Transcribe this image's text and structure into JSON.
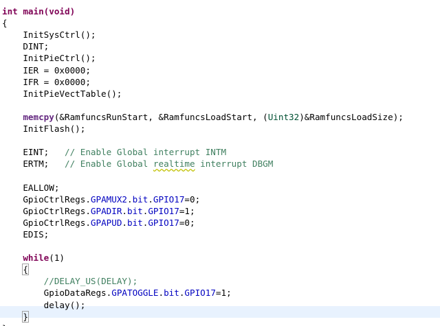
{
  "editor": {
    "lines": [
      {
        "segments": [
          {
            "t": "int main(void)",
            "c": "kw"
          }
        ]
      },
      {
        "segments": [
          {
            "t": "{"
          }
        ]
      },
      {
        "segments": [
          {
            "t": "    InitSysCtrl();"
          }
        ]
      },
      {
        "segments": [
          {
            "t": "    DINT;"
          }
        ]
      },
      {
        "segments": [
          {
            "t": "    InitPieCtrl();"
          }
        ]
      },
      {
        "segments": [
          {
            "t": "    IER = 0x0000;"
          }
        ]
      },
      {
        "segments": [
          {
            "t": "    IFR = 0x0000;"
          }
        ]
      },
      {
        "segments": [
          {
            "t": "    InitPieVectTable();"
          }
        ]
      },
      {
        "segments": []
      },
      {
        "segments": [
          {
            "t": "    "
          },
          {
            "t": "memcpy",
            "c": "fn"
          },
          {
            "t": "(&RamfuncsRunStart, &RamfuncsLoadStart, ("
          },
          {
            "t": "Uint32",
            "c": "dt"
          },
          {
            "t": ")&RamfuncsLoadSize);"
          }
        ]
      },
      {
        "segments": [
          {
            "t": "    InitFlash();"
          }
        ]
      },
      {
        "segments": []
      },
      {
        "segments": [
          {
            "t": "    EINT;   "
          },
          {
            "t": "// Enable Global interrupt INTM",
            "c": "cmt"
          }
        ]
      },
      {
        "segments": [
          {
            "t": "    ERTM;   "
          },
          {
            "t": "// Enable Global ",
            "c": "cmt"
          },
          {
            "t": "realtime",
            "c": "cmt spell"
          },
          {
            "t": " interrupt DBGM",
            "c": "cmt"
          }
        ]
      },
      {
        "segments": []
      },
      {
        "segments": [
          {
            "t": "    EALLOW;"
          }
        ]
      },
      {
        "segments": [
          {
            "t": "    GpioCtrlRegs."
          },
          {
            "t": "GPAMUX2",
            "c": "fld"
          },
          {
            "t": "."
          },
          {
            "t": "bit",
            "c": "fld"
          },
          {
            "t": "."
          },
          {
            "t": "GPIO17",
            "c": "fld"
          },
          {
            "t": "=0;"
          }
        ]
      },
      {
        "segments": [
          {
            "t": "    GpioCtrlRegs."
          },
          {
            "t": "GPADIR",
            "c": "fld"
          },
          {
            "t": "."
          },
          {
            "t": "bit",
            "c": "fld"
          },
          {
            "t": "."
          },
          {
            "t": "GPIO17",
            "c": "fld"
          },
          {
            "t": "=1;"
          }
        ]
      },
      {
        "segments": [
          {
            "t": "    GpioCtrlRegs."
          },
          {
            "t": "GPAPUD",
            "c": "fld"
          },
          {
            "t": "."
          },
          {
            "t": "bit",
            "c": "fld"
          },
          {
            "t": "."
          },
          {
            "t": "GPIO17",
            "c": "fld"
          },
          {
            "t": "=0;"
          }
        ]
      },
      {
        "segments": [
          {
            "t": "    EDIS;"
          }
        ]
      },
      {
        "segments": []
      },
      {
        "segments": [
          {
            "t": "    "
          },
          {
            "t": "while",
            "c": "kw"
          },
          {
            "t": "(1)"
          }
        ]
      },
      {
        "segments": [
          {
            "t": "    "
          },
          {
            "t": "{",
            "c": "brace-box"
          }
        ]
      },
      {
        "segments": [
          {
            "t": "        "
          },
          {
            "t": "//DELAY_US(DELAY);",
            "c": "cmt"
          }
        ]
      },
      {
        "segments": [
          {
            "t": "        GpioDataRegs."
          },
          {
            "t": "GPATOGGLE",
            "c": "fld"
          },
          {
            "t": "."
          },
          {
            "t": "bit",
            "c": "fld"
          },
          {
            "t": "."
          },
          {
            "t": "GPIO17",
            "c": "fld"
          },
          {
            "t": "=1;"
          }
        ]
      },
      {
        "segments": [
          {
            "t": "        delay();"
          }
        ]
      },
      {
        "segments": [
          {
            "t": "    "
          },
          {
            "t": "}",
            "c": "brace-box"
          },
          {
            "t": "",
            "c": "caret"
          }
        ]
      },
      {
        "segments": [
          {
            "t": "}"
          }
        ]
      }
    ]
  },
  "colors": {
    "keyword": "#7f0055",
    "field": "#0000c0",
    "comment": "#3f7f5f",
    "type": "#005032",
    "current_line": "#e8f2fe"
  }
}
